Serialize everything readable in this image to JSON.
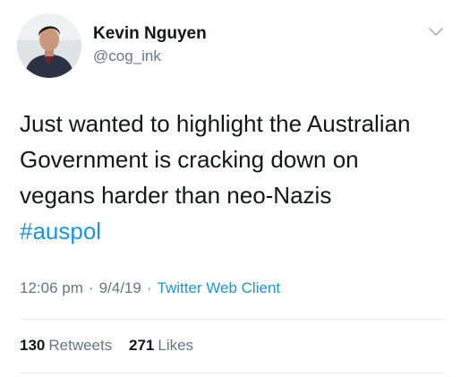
{
  "tweet": {
    "author": {
      "display_name": "Kevin Nguyen",
      "handle": "@cog_ink"
    },
    "text_lines": [
      "Just wanted to highlight the Australian",
      "Government is cracking down on",
      "vegans harder than neo-Nazis"
    ],
    "hashtag": "#auspol",
    "time": "12:06 pm",
    "date": "9/4/19",
    "separator": "·",
    "client": "Twitter Web Client",
    "retweets": {
      "count": "130",
      "label": "Retweets"
    },
    "likes": {
      "count": "271",
      "label": "Likes"
    },
    "colors": {
      "link": "#1b95e0",
      "secondary": "#657786",
      "text": "#14171a"
    },
    "icons": {
      "menu": "chevron-down-icon"
    }
  }
}
